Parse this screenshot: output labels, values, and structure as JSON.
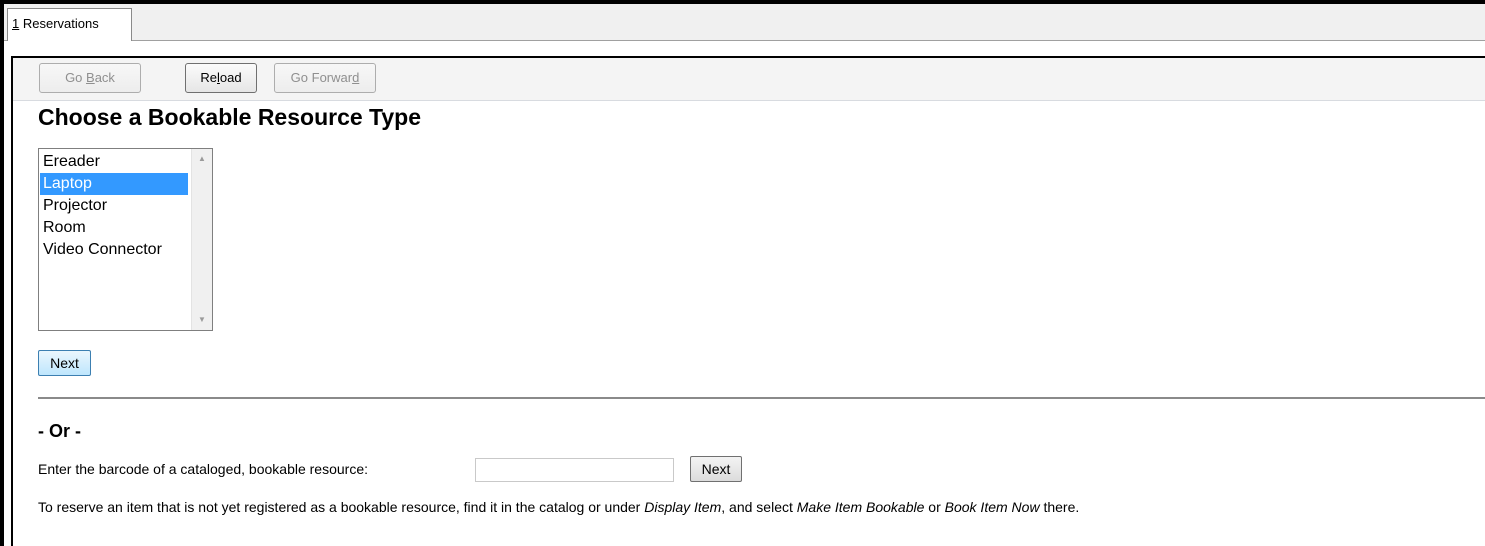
{
  "tab": {
    "number": "1",
    "label": "Reservations"
  },
  "nav": {
    "back_label_pre": "Go ",
    "back_label_acc": "B",
    "back_label_post": "ack",
    "reload_label_pre": "Re",
    "reload_label_acc": "l",
    "reload_label_post": "oad",
    "forward_label_pre": "Go Forwar",
    "forward_label_acc": "d",
    "forward_label_post": ""
  },
  "page": {
    "title": "Choose a Bookable Resource Type",
    "resource_types": [
      "Ereader",
      "Laptop",
      "Projector",
      "Room",
      "Video Connector"
    ],
    "selected_resource_type": "Laptop",
    "next_label": "Next",
    "or_label": "- Or -",
    "barcode_label": "Enter the barcode of a cataloged, bookable resource:",
    "barcode_value": "",
    "barcode_next_label": "Next",
    "instructions": {
      "part1": "To reserve an item that is not yet registered as a bookable resource, find it in the catalog or under ",
      "display_item": "Display Item",
      "part2": ", and select ",
      "make_bookable": "Make Item Bookable",
      "part3": " or ",
      "book_now": "Book Item Now",
      "part4": " there."
    }
  },
  "icons": {
    "scroll_up": "scroll-up-arrow-icon",
    "scroll_down": "scroll-down-arrow-icon"
  },
  "colors": {
    "selection": "#3399ff",
    "primary_button": "#bee6fd"
  }
}
